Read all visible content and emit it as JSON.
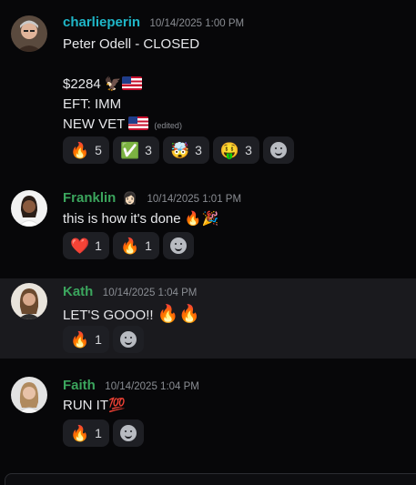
{
  "messages": [
    {
      "author": "charlieperin",
      "author_color": "#1fb6c8",
      "timestamp": "10/14/2025 1:00 PM",
      "lines": [
        "Peter Odell -  CLOSED",
        "$2284",
        "EFT: IMM",
        "NEW VET"
      ],
      "edited_label": "(edited)",
      "extra_emoji": [
        "🦅",
        "🇺🇸"
      ],
      "reactions": [
        {
          "emoji": "🔥",
          "count": "5"
        },
        {
          "emoji": "✅",
          "count": "3"
        },
        {
          "emoji": "🤯",
          "count": "3"
        },
        {
          "emoji": "🤑",
          "count": "3"
        }
      ]
    },
    {
      "author": "Franklin",
      "author_badge": "👩🏻",
      "author_color": "#3ba55d",
      "timestamp": "10/14/2025 1:01 PM",
      "text": "this is how it's done",
      "text_emoji": "🔥🎉",
      "reactions": [
        {
          "emoji": "❤️",
          "count": "1"
        },
        {
          "emoji": "🔥",
          "count": "1"
        }
      ]
    },
    {
      "author": "Kath",
      "author_color": "#3ba55d",
      "timestamp": "10/14/2025 1:04 PM",
      "text": "LET'S GOOO!!",
      "text_emoji": "🔥🔥",
      "reactions": [
        {
          "emoji": "🔥",
          "count": "1"
        }
      ]
    },
    {
      "author": "Faith",
      "author_color": "#3ba55d",
      "timestamp": "10/14/2025 1:04 PM",
      "text": "RUN IT",
      "text_emoji": "💯",
      "reactions": [
        {
          "emoji": "🔥",
          "count": "1"
        }
      ]
    }
  ],
  "icons": {
    "add_reaction": "smile-plus-icon",
    "flag": "us-flag-icon",
    "eagle": "eagle-icon"
  }
}
